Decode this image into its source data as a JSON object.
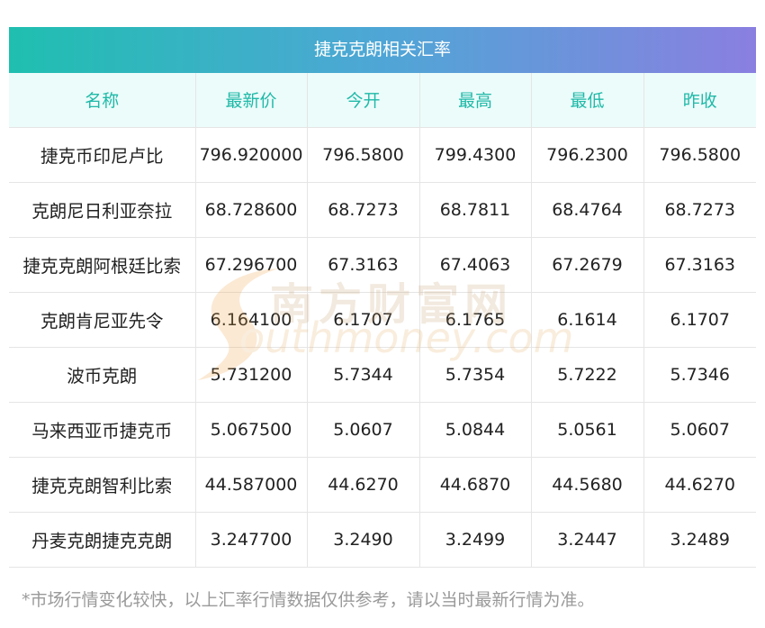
{
  "banner_title": "捷克克朗相关汇率",
  "headers": [
    "名称",
    "最新价",
    "今开",
    "最高",
    "最低",
    "昨收"
  ],
  "rows": [
    [
      "捷克币印尼卢比",
      "796.920000",
      "796.5800",
      "799.4300",
      "796.2300",
      "796.5800"
    ],
    [
      "克朗尼日利亚奈拉",
      "68.728600",
      "68.7273",
      "68.7811",
      "68.4764",
      "68.7273"
    ],
    [
      "捷克克朗阿根廷比索",
      "67.296700",
      "67.3163",
      "67.4063",
      "67.2679",
      "67.3163"
    ],
    [
      "克朗肯尼亚先令",
      "6.164100",
      "6.1707",
      "6.1765",
      "6.1614",
      "6.1707"
    ],
    [
      "波币克朗",
      "5.731200",
      "5.7344",
      "5.7354",
      "5.7222",
      "5.7346"
    ],
    [
      "马来西亚币捷克币",
      "5.067500",
      "5.0607",
      "5.0844",
      "5.0561",
      "5.0607"
    ],
    [
      "捷克克朗智利比索",
      "44.587000",
      "44.6270",
      "44.6870",
      "44.5680",
      "44.6270"
    ],
    [
      "丹麦克朗捷克克朗",
      "3.247700",
      "3.2490",
      "3.2499",
      "3.2447",
      "3.2489"
    ]
  ],
  "watermark": {
    "cn": "南方财富网",
    "en": "outhmoney.com"
  },
  "footnote": "*市场行情变化较快，以上汇率行情数据仅供参考，请以当时最新行情为准。",
  "colors": {
    "banner_start": "#1fbfb0",
    "banner_end": "#8a7fe0",
    "header_text": "#1fb9a8",
    "header_bg": "#ecfcfa"
  }
}
